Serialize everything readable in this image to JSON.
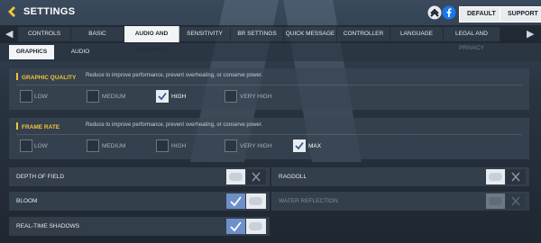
{
  "header": {
    "title": "SETTINGS",
    "default_label": "DEFAULT",
    "support_label": "SUPPORT"
  },
  "tabs": [
    {
      "label": "CONTROLS"
    },
    {
      "label": "BASIC"
    },
    {
      "label": "AUDIO AND GRAPHICS",
      "active": true
    },
    {
      "label": "SENSITIVITY"
    },
    {
      "label": "BR SETTINGS"
    },
    {
      "label": "QUICK MESSAGE"
    },
    {
      "label": "CONTROLLER"
    },
    {
      "label": "LANGUAGE"
    },
    {
      "label": "LEGAL AND PRIVACY"
    }
  ],
  "subtabs": [
    {
      "label": "GRAPHICS",
      "active": true
    },
    {
      "label": "AUDIO"
    }
  ],
  "graphic_quality": {
    "title": "GRAPHIC QUALITY",
    "description": "Reduce to improve performance, prevent overheating, or conserve power.",
    "options": [
      "LOW",
      "MEDIUM",
      "HIGH",
      "VERY HIGH"
    ],
    "selected": "HIGH"
  },
  "frame_rate": {
    "title": "FRAME RATE",
    "description": "Reduce to improve performance, prevent overheating, or conserve power.",
    "options": [
      "LOW",
      "MEDIUM",
      "HIGH",
      "VERY HIGH",
      "MAX"
    ],
    "selected": "MAX"
  },
  "toggles": {
    "depth_of_field": {
      "label": "DEPTH OF FIELD",
      "on": false
    },
    "ragdoll": {
      "label": "RAGDOLL",
      "on": false
    },
    "bloom": {
      "label": "BLOOM",
      "on": true
    },
    "water_reflection": {
      "label": "WATER REFLECTION",
      "on": false,
      "disabled": true
    },
    "real_time_shadows": {
      "label": "REAL-TIME SHADOWS",
      "on": true
    }
  },
  "colors": {
    "accent_yellow": "#f0c43a",
    "toggle_on_blue": "#6f8fc8",
    "toggle_off_grey": "#e8ecf1"
  }
}
